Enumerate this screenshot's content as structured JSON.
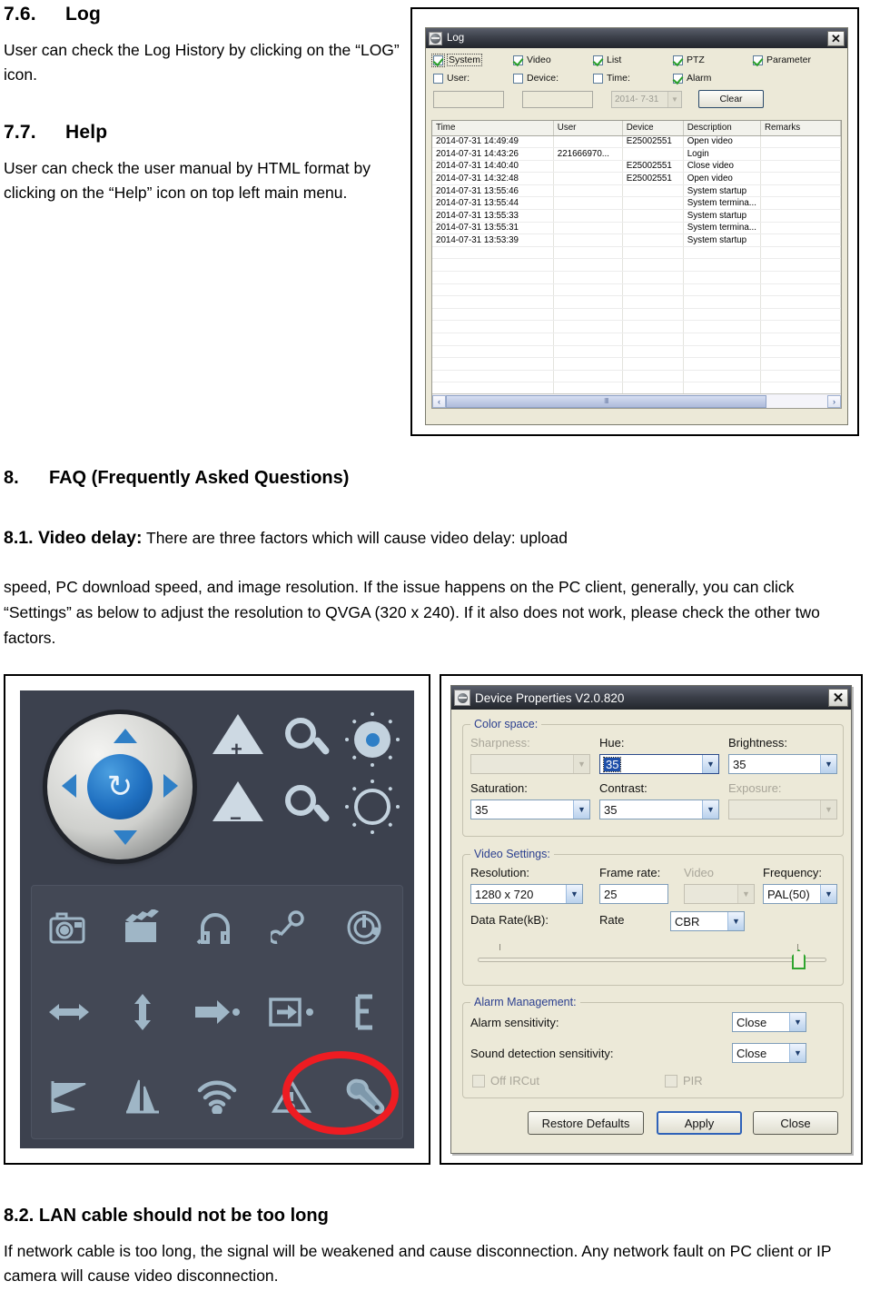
{
  "document": {
    "sections": [
      {
        "number": "7.6.",
        "title": "Log",
        "body": "User can check the Log History by clicking on the “LOG” icon."
      },
      {
        "number": "7.7.",
        "title": "Help",
        "body": "User can check the user manual by HTML format by clicking on the “Help” icon on top left main menu."
      }
    ],
    "faq": {
      "number": "8.",
      "title": "FAQ (Frequently Asked Questions)",
      "items": [
        {
          "number": "8.1. Video delay:",
          "lead": " There are three factors which will cause video delay: upload",
          "body": "speed, PC download speed, and image resolution. If the issue happens on the PC client, generally, you can click “Settings” as below to adjust the resolution to QVGA (320 x 240). If it also does not work, please check the other two factors."
        },
        {
          "number": "8.2. LAN cable should not be too long",
          "body": "If network cable is too long, the signal will be weakened and cause disconnection. Any network fault on PC client or IP camera will cause video disconnection."
        }
      ]
    }
  },
  "log_dialog": {
    "title": "Log",
    "close_label": "✕",
    "checkboxes_row1": [
      {
        "label": "System",
        "checked": true,
        "focused": true
      },
      {
        "label": "Video",
        "checked": true,
        "focused": false
      },
      {
        "label": "List",
        "checked": true,
        "focused": false
      },
      {
        "label": "PTZ",
        "checked": true,
        "focused": false
      },
      {
        "label": "Parameter",
        "checked": true,
        "focused": false
      }
    ],
    "checkboxes_row2": [
      {
        "label": "User:",
        "checked": false
      },
      {
        "label": "Device:",
        "checked": false
      },
      {
        "label": "Time:",
        "checked": false
      },
      {
        "label": "Alarm",
        "checked": true
      }
    ],
    "user_input": "",
    "device_input": "",
    "date_value": "2014-  7-31",
    "clear_button": "Clear",
    "columns": [
      "Time",
      "User",
      "Device",
      "Description",
      "Remarks"
    ],
    "rows": [
      [
        "2014-07-31 14:49:49",
        "",
        "E25002551",
        "Open video",
        ""
      ],
      [
        "2014-07-31 14:43:26",
        "221666970...",
        "",
        "Login",
        ""
      ],
      [
        "2014-07-31 14:40:40",
        "",
        "E25002551",
        "Close video",
        ""
      ],
      [
        "2014-07-31 14:32:48",
        "",
        "E25002551",
        "Open video",
        ""
      ],
      [
        "2014-07-31 13:55:46",
        "",
        "",
        "System startup",
        ""
      ],
      [
        "2014-07-31 13:55:44",
        "",
        "",
        "System termina...",
        ""
      ],
      [
        "2014-07-31 13:55:33",
        "",
        "",
        "System startup",
        ""
      ],
      [
        "2014-07-31 13:55:31",
        "",
        "",
        "System termina...",
        ""
      ],
      [
        "2014-07-31 13:53:39",
        "",
        "",
        "System startup",
        ""
      ],
      [
        "",
        "",
        "",
        "",
        ""
      ],
      [
        "",
        "",
        "",
        "",
        ""
      ],
      [
        "",
        "",
        "",
        "",
        ""
      ],
      [
        "",
        "",
        "",
        "",
        ""
      ],
      [
        "",
        "",
        "",
        "",
        ""
      ],
      [
        "",
        "",
        "",
        "",
        ""
      ],
      [
        "",
        "",
        "",
        "",
        ""
      ],
      [
        "",
        "",
        "",
        "",
        ""
      ],
      [
        "",
        "",
        "",
        "",
        ""
      ],
      [
        "",
        "",
        "",
        "",
        ""
      ],
      [
        "",
        "",
        "",
        "",
        ""
      ],
      [
        "",
        "",
        "",
        "",
        ""
      ]
    ],
    "scroll_left": "‹",
    "scroll_right": "›",
    "scroll_grip": "‖‖"
  },
  "control_panel": {
    "ptz": {
      "center_icon": "refresh-icon",
      "center_glyph": "↻",
      "directions": [
        "up",
        "left",
        "right",
        "down"
      ]
    },
    "side_buttons": [
      "focus-near-icon",
      "zoom-out-icon",
      "iris-open-icon",
      "focus-far-icon",
      "zoom-in-icon",
      "iris-close-icon"
    ],
    "grid_icons": [
      "snapshot-icon",
      "record-icon",
      "headphone-icon",
      "microphone-icon",
      "power-icon",
      "horizontal-flip-icon",
      "vertical-flip-icon",
      "preset-go-icon",
      "preset-set-icon",
      "bracket-icon",
      "tilt-patrol-icon",
      "pan-patrol-icon",
      "wifi-icon",
      "alarm-icon",
      "settings-icon"
    ],
    "highlight": {
      "target": "settings-icon",
      "color": "#ee1c22"
    }
  },
  "device_properties": {
    "title": "Device Properties V2.0.820",
    "close_label": "✕",
    "groups": [
      {
        "label": "Color space:",
        "fields": [
          {
            "name": "Sharpness:",
            "value": "",
            "disabled": true
          },
          {
            "name": "Hue:",
            "value": "35",
            "highlighted": true
          },
          {
            "name": "Brightness:",
            "value": "35"
          },
          {
            "name": "Saturation:",
            "value": "35"
          },
          {
            "name": "Contrast:",
            "value": "35"
          },
          {
            "name": "Exposure:",
            "value": "",
            "disabled": true
          }
        ]
      },
      {
        "label": "Video Settings:",
        "fields": [
          {
            "name": "Resolution:",
            "value": "1280 x 720"
          },
          {
            "name": "Frame rate:",
            "value": "25"
          },
          {
            "name": "Video",
            "value": "",
            "disabled": true
          },
          {
            "name": "Frequency:",
            "value": "PAL(50)"
          },
          {
            "name": "Data Rate(kB):",
            "value": ""
          },
          {
            "name": "Rate",
            "value": "CBR"
          }
        ]
      },
      {
        "label": "Alarm Management:",
        "fields": [
          {
            "name": "Alarm sensitivity:",
            "value": "Close"
          },
          {
            "name": "Sound detection sensitivity:",
            "value": "Close"
          },
          {
            "name": "Off IRCut",
            "value": "",
            "disabled": true
          },
          {
            "name": "PIR",
            "value": "",
            "disabled": true
          }
        ]
      }
    ],
    "buttons": [
      {
        "label": "Restore Defaults",
        "primary": false
      },
      {
        "label": "Apply",
        "primary": true
      },
      {
        "label": "Close",
        "primary": false
      }
    ]
  }
}
